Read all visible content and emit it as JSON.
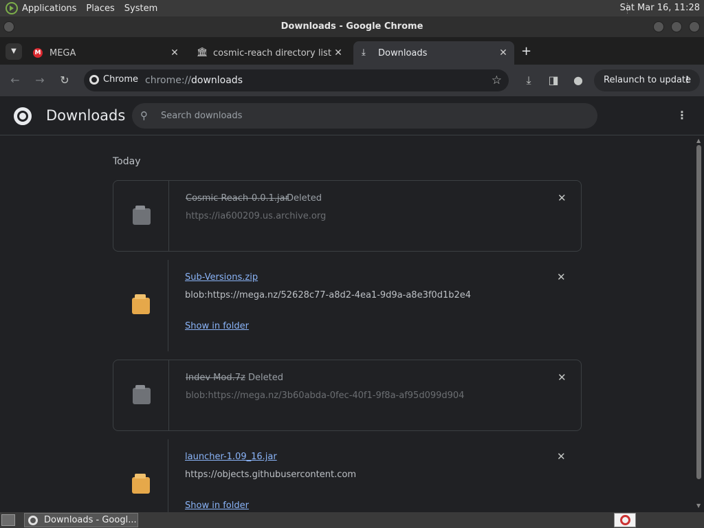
{
  "panel": {
    "menus": [
      "Applications",
      "Places",
      "System"
    ],
    "clock": "Sat Mar 16, 11:28"
  },
  "window": {
    "title": "Downloads - Google Chrome"
  },
  "tabs": [
    {
      "label": "MEGA",
      "icon": "mega-icon"
    },
    {
      "label": "cosmic-reach directory listing",
      "icon": "archive-icon"
    },
    {
      "label": "Downloads",
      "icon": "download-icon",
      "active": true
    }
  ],
  "toolbar": {
    "site_chip": "Chrome",
    "url_scheme": "chrome://",
    "url_host": "downloads",
    "relaunch_label": "Relaunch to update"
  },
  "downloads": {
    "title": "Downloads",
    "search_placeholder": "Search downloads",
    "date_group": "Today",
    "show_in_folder": "Show in folder",
    "items": [
      {
        "name": "Cosmic Reach-0.0.1.jar",
        "status": "Deleted",
        "url": "https://ia600209.us.archive.org",
        "deleted": true
      },
      {
        "name": "Sub-Versions.zip",
        "status": "",
        "url": "blob:https://mega.nz/52628c77-a8d2-4ea1-9d9a-a8e3f0d1b2e4",
        "deleted": false
      },
      {
        "name": "Indev Mod.7z",
        "status": "Deleted",
        "url": "blob:https://mega.nz/3b60abda-0fec-40f1-9f8a-af95d099d904",
        "deleted": true
      },
      {
        "name": "launcher-1.09_16.jar",
        "status": "",
        "url": "https://objects.githubusercontent.com",
        "deleted": false
      }
    ]
  },
  "taskbar": {
    "task_label": "Downloads - Googl..."
  },
  "colors": {
    "accent_link": "#8ab4f8",
    "background": "#202124",
    "file_gold": "#e6a84a"
  }
}
